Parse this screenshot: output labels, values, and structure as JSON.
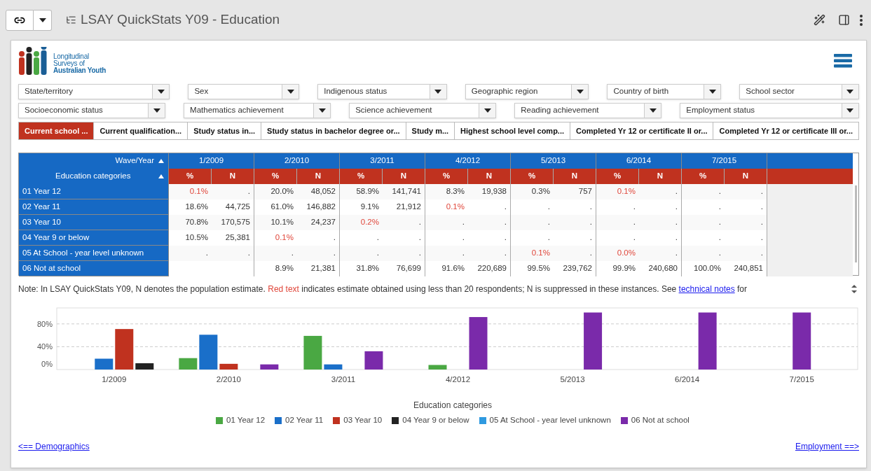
{
  "header": {
    "title": "LSAY QuickStats Y09 - Education"
  },
  "logo": {
    "lines": [
      "Longitudinal",
      "Surveys of",
      "Australian Youth"
    ]
  },
  "filters": [
    [
      {
        "label": "State/territory"
      },
      {
        "label": "Sex"
      },
      {
        "label": "Indigenous status"
      },
      {
        "label": "Geographic region"
      },
      {
        "label": "Country of birth"
      },
      {
        "label": "School sector"
      }
    ],
    [
      {
        "label": "Socioeconomic status"
      },
      {
        "label": "Mathematics achievement"
      },
      {
        "label": "Science achievement"
      },
      {
        "label": "Reading achievement"
      },
      {
        "label": "Employment status"
      }
    ]
  ],
  "tabs": [
    {
      "label": "Current school ...",
      "selected": true
    },
    {
      "label": "Current qualification...",
      "selected": false
    },
    {
      "label": "Study status in...",
      "selected": false
    },
    {
      "label": "Study status in bachelor degree or...",
      "selected": false
    },
    {
      "label": "Study m...",
      "selected": false
    },
    {
      "label": "Highest school level comp...",
      "selected": false
    },
    {
      "label": "Completed Yr 12 or certificate II or...",
      "selected": false
    },
    {
      "label": "Completed Yr 12 or certificate III or...",
      "selected": false
    }
  ],
  "table": {
    "corner_top": "Wave/Year",
    "corner_bottom": "Education categories",
    "waves": [
      {
        "label": "1/2009",
        "subcolumns": [
          "%",
          "N"
        ]
      },
      {
        "label": "2/2010",
        "subcolumns": [
          "%",
          "N"
        ]
      },
      {
        "label": "3/2011",
        "subcolumns": [
          "%",
          "N"
        ]
      },
      {
        "label": "4/2012",
        "subcolumns": [
          "%",
          "N"
        ]
      },
      {
        "label": "5/2013",
        "subcolumns": [
          "%",
          "N"
        ]
      },
      {
        "label": "6/2014",
        "subcolumns": [
          "%",
          "N"
        ]
      },
      {
        "label": "7/2015",
        "subcolumns": [
          "%",
          "N"
        ]
      }
    ],
    "rows": [
      {
        "label": "01 Year 12",
        "cells": [
          {
            "v": "0.1%",
            "red": true
          },
          {
            "v": ".",
            "red": false
          },
          {
            "v": "20.0%",
            "red": false
          },
          {
            "v": "48,052",
            "red": false
          },
          {
            "v": "58.9%",
            "red": false
          },
          {
            "v": "141,741",
            "red": false
          },
          {
            "v": "8.3%",
            "red": false
          },
          {
            "v": "19,938",
            "red": false
          },
          {
            "v": "0.3%",
            "red": false
          },
          {
            "v": "757",
            "red": false
          },
          {
            "v": "0.1%",
            "red": true
          },
          {
            "v": ".",
            "red": false
          },
          {
            "v": ".",
            "red": false
          },
          {
            "v": ".",
            "red": false
          }
        ]
      },
      {
        "label": "02 Year 11",
        "cells": [
          {
            "v": "18.6%",
            "red": false
          },
          {
            "v": "44,725",
            "red": false
          },
          {
            "v": "61.0%",
            "red": false
          },
          {
            "v": "146,882",
            "red": false
          },
          {
            "v": "9.1%",
            "red": false
          },
          {
            "v": "21,912",
            "red": false
          },
          {
            "v": "0.1%",
            "red": true
          },
          {
            "v": ".",
            "red": false
          },
          {
            "v": ".",
            "red": false
          },
          {
            "v": ".",
            "red": false
          },
          {
            "v": ".",
            "red": false
          },
          {
            "v": ".",
            "red": false
          },
          {
            "v": ".",
            "red": false
          },
          {
            "v": ".",
            "red": false
          }
        ]
      },
      {
        "label": "03 Year 10",
        "cells": [
          {
            "v": "70.8%",
            "red": false
          },
          {
            "v": "170,575",
            "red": false
          },
          {
            "v": "10.1%",
            "red": false
          },
          {
            "v": "24,237",
            "red": false
          },
          {
            "v": "0.2%",
            "red": true
          },
          {
            "v": ".",
            "red": false
          },
          {
            "v": ".",
            "red": false
          },
          {
            "v": ".",
            "red": false
          },
          {
            "v": ".",
            "red": false
          },
          {
            "v": ".",
            "red": false
          },
          {
            "v": ".",
            "red": false
          },
          {
            "v": ".",
            "red": false
          },
          {
            "v": ".",
            "red": false
          },
          {
            "v": ".",
            "red": false
          }
        ]
      },
      {
        "label": "04 Year 9 or below",
        "cells": [
          {
            "v": "10.5%",
            "red": false
          },
          {
            "v": "25,381",
            "red": false
          },
          {
            "v": "0.1%",
            "red": true
          },
          {
            "v": ".",
            "red": false
          },
          {
            "v": ".",
            "red": false
          },
          {
            "v": ".",
            "red": false
          },
          {
            "v": ".",
            "red": false
          },
          {
            "v": ".",
            "red": false
          },
          {
            "v": ".",
            "red": false
          },
          {
            "v": ".",
            "red": false
          },
          {
            "v": ".",
            "red": false
          },
          {
            "v": ".",
            "red": false
          },
          {
            "v": ".",
            "red": false
          },
          {
            "v": ".",
            "red": false
          }
        ]
      },
      {
        "label": "05 At School - year level unknown",
        "cells": [
          {
            "v": ".",
            "red": false
          },
          {
            "v": ".",
            "red": false
          },
          {
            "v": ".",
            "red": false
          },
          {
            "v": ".",
            "red": false
          },
          {
            "v": ".",
            "red": false
          },
          {
            "v": ".",
            "red": false
          },
          {
            "v": ".",
            "red": false
          },
          {
            "v": ".",
            "red": false
          },
          {
            "v": "0.1%",
            "red": true
          },
          {
            "v": ".",
            "red": false
          },
          {
            "v": "0.0%",
            "red": true
          },
          {
            "v": ".",
            "red": false
          },
          {
            "v": ".",
            "red": false
          },
          {
            "v": ".",
            "red": false
          }
        ]
      },
      {
        "label": "06 Not at school",
        "cells": [
          null,
          null,
          {
            "v": "8.9%",
            "red": false
          },
          {
            "v": "21,381",
            "red": false
          },
          {
            "v": "31.8%",
            "red": false
          },
          {
            "v": "76,699",
            "red": false
          },
          {
            "v": "91.6%",
            "red": false
          },
          {
            "v": "220,689",
            "red": false
          },
          {
            "v": "99.5%",
            "red": false
          },
          {
            "v": "239,762",
            "red": false
          },
          {
            "v": "99.9%",
            "red": false
          },
          {
            "v": "240,680",
            "red": false
          },
          {
            "v": "100.0%",
            "red": false
          },
          {
            "v": "240,851",
            "red": false
          }
        ]
      }
    ]
  },
  "note": {
    "parts": [
      {
        "kind": "plain",
        "text": "Note: In LSAY QuickStats Y09, N denotes the population estimate. "
      },
      {
        "kind": "red",
        "text": "Red text"
      },
      {
        "kind": "plain",
        "text": " indicates estimate obtained using less than 20 respondents; N is suppressed in these instances. See "
      },
      {
        "kind": "link",
        "text": "technical notes"
      },
      {
        "kind": "plain",
        "text": " for"
      }
    ]
  },
  "chart": {
    "chart_data": {
      "type": "bar",
      "xlabel": "Education categories",
      "legend": "bottom",
      "categories": [
        "1/2009",
        "2/2010",
        "3/2011",
        "4/2012",
        "5/2013",
        "6/2014",
        "7/2015"
      ],
      "ylim": [
        0,
        108
      ],
      "yticks": [
        {
          "value": 0,
          "label": "0%"
        },
        {
          "value": 40,
          "label": "40%"
        },
        {
          "value": 80,
          "label": "80%"
        }
      ],
      "series": [
        {
          "name": "01 Year 12",
          "color": "#4aa843",
          "values": [
            0,
            20,
            59,
            8,
            0,
            0,
            null
          ]
        },
        {
          "name": "02 Year 11",
          "color": "#1a6fc9",
          "values": [
            19,
            61,
            9,
            0,
            null,
            null,
            null
          ]
        },
        {
          "name": "03 Year 10",
          "color": "#c0321f",
          "values": [
            71,
            10,
            0,
            null,
            null,
            null,
            null
          ]
        },
        {
          "name": "04 Year 9 or below",
          "color": "#222222",
          "values": [
            11,
            0,
            null,
            null,
            null,
            null,
            null
          ]
        },
        {
          "name": "05 At School - year level unknown",
          "color": "#2f9ae0",
          "values": [
            null,
            null,
            null,
            null,
            0,
            0,
            null
          ]
        },
        {
          "name": "06 Not at school",
          "color": "#7a2aaa",
          "values": [
            null,
            9,
            32,
            92,
            100,
            100,
            100
          ]
        }
      ]
    }
  },
  "nav": {
    "previous": "<== Demographics",
    "next": "Employment ==>"
  }
}
